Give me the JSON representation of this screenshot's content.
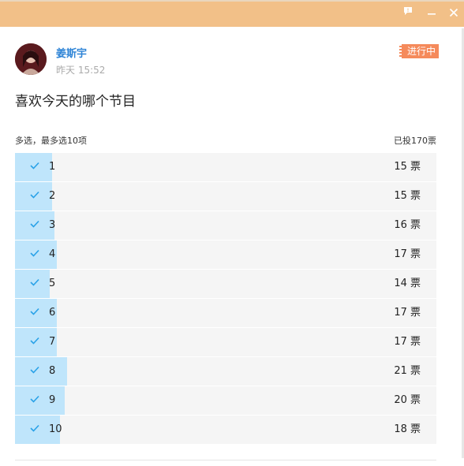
{
  "titlebar": {
    "icons": [
      "feedback-icon",
      "minimize-icon",
      "close-icon"
    ]
  },
  "post": {
    "author": "姜斯宇",
    "time": "昨天 15:52",
    "status": "进行中",
    "question": "喜欢今天的哪个节目"
  },
  "poll": {
    "rule": "多选，最多选10项",
    "total": "已投170票",
    "max_votes": 21,
    "options": [
      {
        "label": "1",
        "votes": 15,
        "count_text": "15 票",
        "checked": true
      },
      {
        "label": "2",
        "votes": 15,
        "count_text": "15 票",
        "checked": true
      },
      {
        "label": "3",
        "votes": 16,
        "count_text": "16 票",
        "checked": true
      },
      {
        "label": "4",
        "votes": 17,
        "count_text": "17 票",
        "checked": true
      },
      {
        "label": "5",
        "votes": 14,
        "count_text": "14 票",
        "checked": true
      },
      {
        "label": "6",
        "votes": 17,
        "count_text": "17 票",
        "checked": true
      },
      {
        "label": "7",
        "votes": 17,
        "count_text": "17 票",
        "checked": true
      },
      {
        "label": "8",
        "votes": 21,
        "count_text": "21 票",
        "checked": true
      },
      {
        "label": "9",
        "votes": 20,
        "count_text": "20 票",
        "checked": true
      },
      {
        "label": "10",
        "votes": 18,
        "count_text": "18 票",
        "checked": true
      }
    ]
  },
  "colors": {
    "titlebar": "#f2c088",
    "accent": "#2e84d6",
    "status": "#f58a5b",
    "fill": "#bfe5fb"
  }
}
